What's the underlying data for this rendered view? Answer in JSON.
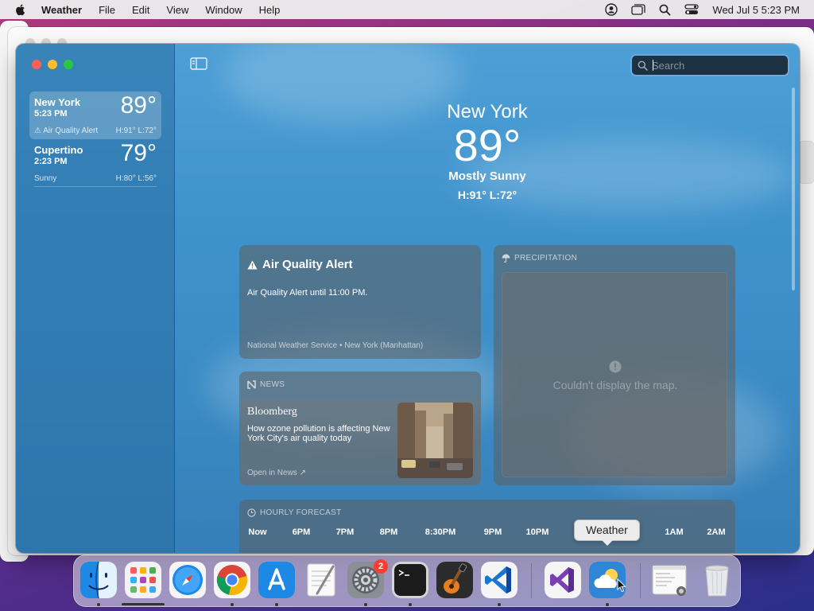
{
  "menubar": {
    "app_name": "Weather",
    "items": [
      "File",
      "Edit",
      "View",
      "Window",
      "Help"
    ],
    "clock": "Wed Jul 5  5:23 PM"
  },
  "sidebar": {
    "locations": [
      {
        "name": "New York",
        "time": "5:23 PM",
        "temp": "89°",
        "condition": "Air Quality Alert",
        "hl": "H:91°  L:72°",
        "selected": true
      },
      {
        "name": "Cupertino",
        "time": "2:23 PM",
        "temp": "79°",
        "condition": "Sunny",
        "hl": "H:80°  L:56°",
        "selected": false
      }
    ]
  },
  "search": {
    "placeholder": "Search",
    "value": ""
  },
  "hero": {
    "city": "New York",
    "temp": "89°",
    "condition": "Mostly Sunny",
    "hl": "H:91°  L:72°"
  },
  "alert": {
    "title": "Air Quality Alert",
    "text": "Air Quality Alert until 11:00 PM.",
    "source": "National Weather Service • New York (Manhattan)"
  },
  "news": {
    "header": "NEWS",
    "publisher": "Bloomberg",
    "headline": "How ozone pollution is affecting New York City's air quality today",
    "open_label": "Open in News ↗"
  },
  "precipitation": {
    "header": "PRECIPITATION",
    "error": "Couldn't display the map."
  },
  "hourly": {
    "header": "HOURLY FORECAST",
    "hours": [
      "Now",
      "6PM",
      "7PM",
      "8PM",
      "8:30PM",
      "9PM",
      "10PM",
      "1AM",
      "2AM"
    ]
  },
  "dock": {
    "apps": [
      "Finder",
      "Launchpad",
      "Safari",
      "Chrome",
      "App Store",
      "TextEdit",
      "System Settings",
      "Terminal",
      "GarageBand",
      "VS Code",
      "Visual Studio",
      "Weather",
      "Preview",
      "Trash"
    ],
    "tooltip": "Weather",
    "settings_badge": "2"
  },
  "colors": {
    "sky": "#4d9fd6",
    "card": "#5f5f5f",
    "accent": "#6ea8dc"
  }
}
